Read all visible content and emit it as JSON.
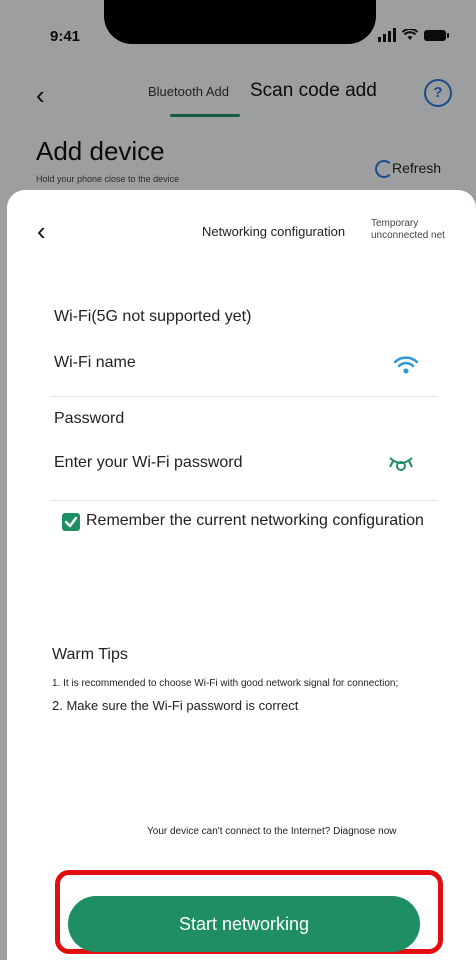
{
  "status_bar": {
    "time": "9:41"
  },
  "background": {
    "tabs": [
      {
        "label": "Bluetooth Add"
      },
      {
        "label": "Scan code add"
      }
    ],
    "title": "Add device",
    "subtitle": "Hold your phone close to the device",
    "refresh_label": "Refresh",
    "help_label": "?"
  },
  "sheet": {
    "title": "Networking configuration",
    "top_right": "Temporary unconnected net",
    "wifi_header": "Wi-Fi(5G not supported yet)",
    "wifi_name_label": "Wi-Fi name",
    "password_label": "Password",
    "password_placeholder": "Enter your Wi-Fi password",
    "remember_label": "Remember the current networking configuration",
    "remember_checked": true,
    "tips_title": "Warm Tips",
    "tips": [
      "1. It is recommended to choose Wi-Fi with good network signal for connection;",
      "2. Make sure the Wi-Fi password is correct"
    ],
    "diagnose_text": "Your device can't connect to the Internet? Diagnose now",
    "start_button": "Start networking"
  },
  "colors": {
    "accent": "#1f8f63",
    "highlight": "#e01010",
    "link": "#2b75d8"
  }
}
